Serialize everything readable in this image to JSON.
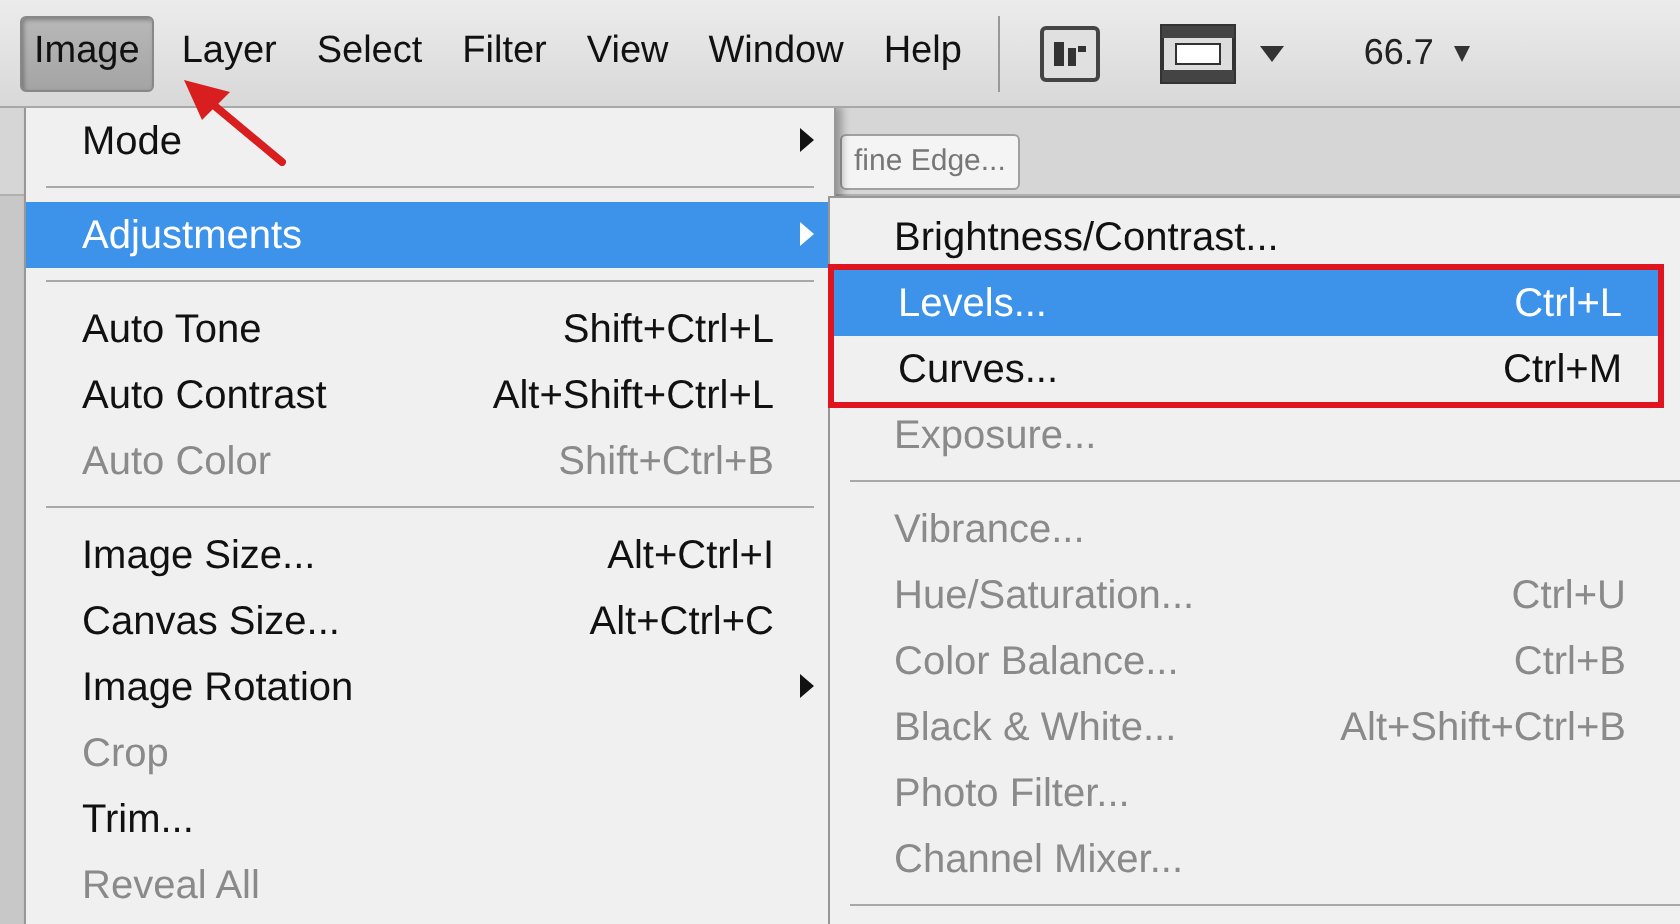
{
  "menu_bar": {
    "items": [
      {
        "label": "Image",
        "selected": true,
        "pointer_arrow": true
      },
      {
        "label": "Layer",
        "selected": false,
        "pointer_arrow": false
      },
      {
        "label": "Select",
        "selected": false,
        "pointer_arrow": false
      },
      {
        "label": "Filter",
        "selected": false,
        "pointer_arrow": false
      },
      {
        "label": "View",
        "selected": false,
        "pointer_arrow": false
      },
      {
        "label": "Window",
        "selected": false,
        "pointer_arrow": false
      },
      {
        "label": "Help",
        "selected": false,
        "pointer_arrow": false
      }
    ],
    "zoom": "66.7"
  },
  "options_bar": {
    "tab": "fine Edge..."
  },
  "image_menu": [
    {
      "kind": "item",
      "label": "Mode",
      "submenu": true,
      "selected": false,
      "disabled": false
    },
    {
      "kind": "separator"
    },
    {
      "kind": "item",
      "label": "Adjustments",
      "submenu": true,
      "selected": true,
      "disabled": false
    },
    {
      "kind": "separator"
    },
    {
      "kind": "item",
      "label": "Auto Tone",
      "shortcut": "Shift+Ctrl+L",
      "selected": false,
      "disabled": false
    },
    {
      "kind": "item",
      "label": "Auto Contrast",
      "shortcut": "Alt+Shift+Ctrl+L",
      "selected": false,
      "disabled": false
    },
    {
      "kind": "item",
      "label": "Auto Color",
      "shortcut": "Shift+Ctrl+B",
      "selected": false,
      "disabled": true
    },
    {
      "kind": "separator"
    },
    {
      "kind": "item",
      "label": "Image Size...",
      "shortcut": "Alt+Ctrl+I",
      "selected": false,
      "disabled": false
    },
    {
      "kind": "item",
      "label": "Canvas Size...",
      "shortcut": "Alt+Ctrl+C",
      "selected": false,
      "disabled": false
    },
    {
      "kind": "item",
      "label": "Image Rotation",
      "submenu": true,
      "selected": false,
      "disabled": false
    },
    {
      "kind": "item",
      "label": "Crop",
      "selected": false,
      "disabled": true
    },
    {
      "kind": "item",
      "label": "Trim...",
      "selected": false,
      "disabled": false
    },
    {
      "kind": "item",
      "label": "Reveal All",
      "selected": false,
      "disabled": true
    }
  ],
  "adjustments_menu": [
    {
      "kind": "item",
      "label": "Brightness/Contrast...",
      "selected": false,
      "disabled": false,
      "boxed": false
    },
    {
      "kind": "item",
      "label": "Levels...",
      "shortcut": "Ctrl+L",
      "selected": true,
      "disabled": false,
      "boxed": true
    },
    {
      "kind": "item",
      "label": "Curves...",
      "shortcut": "Ctrl+M",
      "selected": false,
      "disabled": false,
      "boxed": true
    },
    {
      "kind": "item",
      "label": "Exposure...",
      "selected": false,
      "disabled": true,
      "boxed": false
    },
    {
      "kind": "separator"
    },
    {
      "kind": "item",
      "label": "Vibrance...",
      "selected": false,
      "disabled": true,
      "boxed": false
    },
    {
      "kind": "item",
      "label": "Hue/Saturation...",
      "shortcut": "Ctrl+U",
      "selected": false,
      "disabled": true,
      "boxed": false
    },
    {
      "kind": "item",
      "label": "Color Balance...",
      "shortcut": "Ctrl+B",
      "selected": false,
      "disabled": true,
      "boxed": false
    },
    {
      "kind": "item",
      "label": "Black & White...",
      "shortcut": "Alt+Shift+Ctrl+B",
      "selected": false,
      "disabled": true,
      "boxed": false
    },
    {
      "kind": "item",
      "label": "Photo Filter...",
      "selected": false,
      "disabled": true,
      "boxed": false
    },
    {
      "kind": "item",
      "label": "Channel Mixer...",
      "selected": false,
      "disabled": true,
      "boxed": false
    },
    {
      "kind": "separator"
    }
  ]
}
